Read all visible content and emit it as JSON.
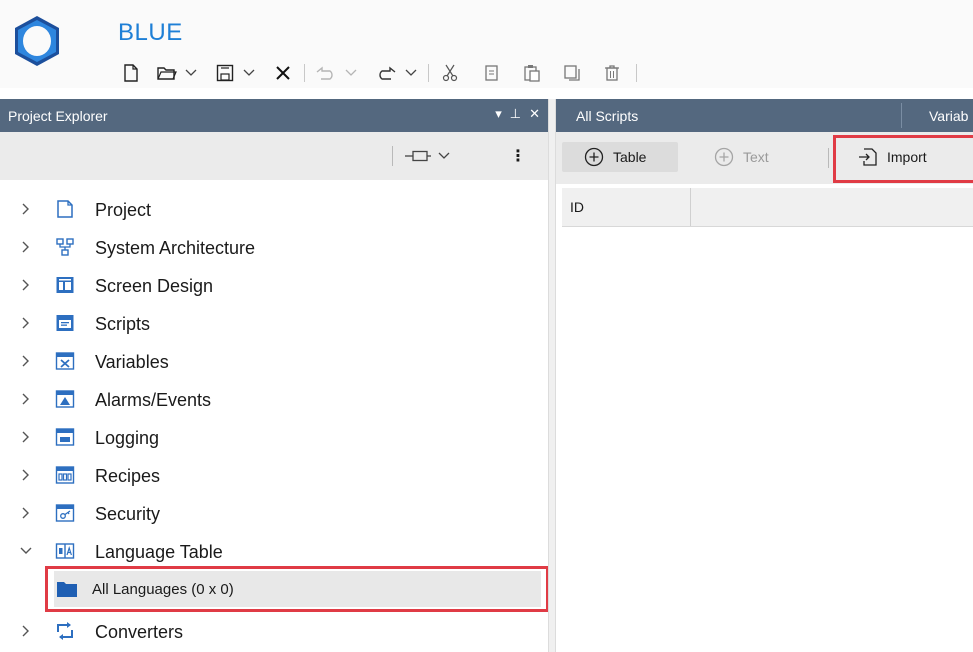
{
  "app": {
    "title": "BLUE"
  },
  "project_explorer": {
    "title": "Project Explorer",
    "controls": {
      "dropdown": "▾",
      "pin": "⊥",
      "close": "✕"
    },
    "tree": [
      {
        "label": "Project",
        "icon": "project-icon",
        "expanded": false
      },
      {
        "label": "System Architecture",
        "icon": "system-architecture-icon",
        "expanded": false
      },
      {
        "label": "Screen Design",
        "icon": "screen-design-icon",
        "expanded": false
      },
      {
        "label": "Scripts",
        "icon": "scripts-icon",
        "expanded": false
      },
      {
        "label": "Variables",
        "icon": "variables-icon",
        "expanded": false
      },
      {
        "label": "Alarms/Events",
        "icon": "alarms-icon",
        "expanded": false
      },
      {
        "label": "Logging",
        "icon": "logging-icon",
        "expanded": false
      },
      {
        "label": "Recipes",
        "icon": "recipes-icon",
        "expanded": false
      },
      {
        "label": "Security",
        "icon": "security-icon",
        "expanded": false
      },
      {
        "label": "Language Table",
        "icon": "language-table-icon",
        "expanded": true
      },
      {
        "label": "Converters",
        "icon": "converters-icon",
        "expanded": false
      }
    ],
    "child": {
      "label": "All Languages (0 x 0)",
      "icon": "folder-icon"
    }
  },
  "tabs": [
    {
      "label": "All Scripts"
    },
    {
      "label": "Variab"
    }
  ],
  "scripts_toolbar": {
    "table_label": "Table",
    "text_label": "Text",
    "import_label": "Import"
  },
  "grid": {
    "columns": [
      "ID"
    ]
  },
  "colors": {
    "accent": "#1e7fd6",
    "panel_header": "#54687f",
    "highlight": "#e03b45",
    "icon_blue": "#2d6fc0"
  }
}
